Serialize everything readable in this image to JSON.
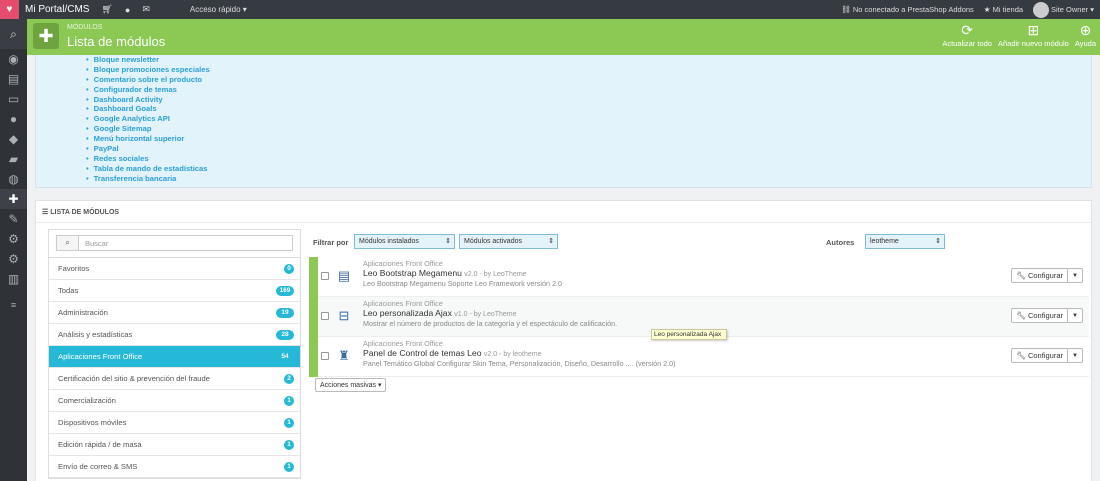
{
  "topbar": {
    "shop_name": "Mi Portal/CMS",
    "quick_access": "Acceso rápido ▾",
    "addons_status": "No conectado a PrestaShop Addons",
    "my_store": "Mi tienda",
    "user": "Site Owner ▾"
  },
  "header": {
    "breadcrumb": "Módulos",
    "title": "Lista de módulos",
    "tools": [
      {
        "label": "Actualizar todo",
        "icon": "refresh-icon"
      },
      {
        "label": "Añadir nuevo módulo",
        "icon": "add-module-icon"
      },
      {
        "label": "Ayuda",
        "icon": "help-icon"
      }
    ]
  },
  "module_links": [
    "Bloque newsletter",
    "Bloque promociones especiales",
    "Comentario sobre el producto",
    "Configurador de temas",
    "Dashboard Activity",
    "Dashboard Goals",
    "Google Analytics API",
    "Google Sitemap",
    "Menú horizontal superior",
    "PayPal",
    "Redes sociales",
    "Tabla de mando de estadísticas",
    "Transferencia bancaria"
  ],
  "list_panel": {
    "heading": "Lista de módulos",
    "search_placeholder": "Buscar",
    "categories": [
      {
        "label": "Favoritos",
        "count": "0"
      },
      {
        "label": "Todas",
        "count": "169"
      },
      {
        "label": "Administración",
        "count": "19"
      },
      {
        "label": "Análisis y estadísticas",
        "count": "28"
      },
      {
        "label": "Aplicaciones Front Office",
        "count": "54"
      },
      {
        "label": "Certificación del sitio & prevención del fraude",
        "count": "2"
      },
      {
        "label": "Comercialización",
        "count": "1"
      },
      {
        "label": "Dispositivos móviles",
        "count": "1"
      },
      {
        "label": "Edición rápida / de masa",
        "count": "1"
      },
      {
        "label": "Envío de correo & SMS",
        "count": "1"
      }
    ],
    "filter_label": "Filtrar por",
    "filter_installed": "Módulos instalados",
    "filter_enabled": "Módulos activados",
    "authors_label": "Autores",
    "authors_value": "leotheme",
    "modules": [
      {
        "category": "Aplicaciones Front Office",
        "name": "Leo Bootstrap Megamenu",
        "version": "v2.0 - by LeoTheme",
        "description": "Leo Bootstrap Megamenu Soporte Leo Framework versión 2.0",
        "configure": "Configurar"
      },
      {
        "category": "Aplicaciones Front Office",
        "name": "Leo personalizada Ajax",
        "version": "v1.0 - by LeoTheme",
        "description": "Mostrar el número de productos de la categoría y el espectáculo de calificación.",
        "configure": "Configurar"
      },
      {
        "category": "Aplicaciones Front Office",
        "name": "Panel de Control de temas Leo",
        "version": "v2.0 - by leotheme",
        "description": "Panel Temático Global Configurar Skin Tema, Personalización, Diseño, Desarrollo .... (versión 2.0)",
        "configure": "Configurar"
      }
    ],
    "bulk_actions": "Acciones masivas ▾"
  },
  "tooltip": "Leo personalizada Ajax"
}
